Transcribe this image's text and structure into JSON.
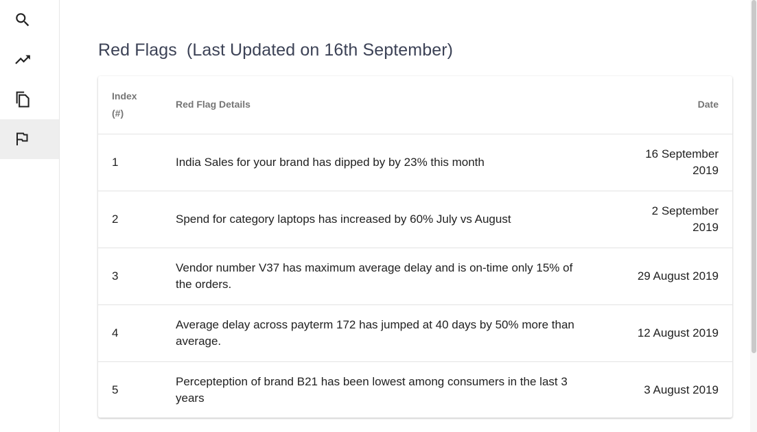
{
  "sidebar": {
    "items": [
      {
        "icon": "search-icon",
        "active": false
      },
      {
        "icon": "trending-up-icon",
        "active": false
      },
      {
        "icon": "copy-icon",
        "active": false
      },
      {
        "icon": "flag-icon",
        "active": true
      }
    ]
  },
  "page": {
    "title": "Red Flags  (Last Updated on 16th September)"
  },
  "table": {
    "headers": {
      "index": "Index (#)",
      "details": "Red Flag Details",
      "date": "Date"
    },
    "rows": [
      {
        "index": "1",
        "details": "India Sales for your brand has dipped by by 23% this month",
        "date": "16 September 2019"
      },
      {
        "index": "2",
        "details": "Spend for category laptops has increased by 60% July vs August",
        "date": "2 September 2019"
      },
      {
        "index": "3",
        "details": "Vendor number V37 has maximum average delay and is on-time only 15% of the orders.",
        "date": "29 August 2019"
      },
      {
        "index": "4",
        "details": "Average delay across payterm 172 has jumped at 40 days by 50% more than average.",
        "date": "12 August 2019"
      },
      {
        "index": "5",
        "details": "Percepteption of brand B21 has been lowest among consumers in the last 3 years",
        "date": "3 August 2019"
      }
    ]
  },
  "colors": {
    "sidebar_active_bg": "#eeeeee",
    "title": "#3c4256",
    "header_text": "#757575",
    "body_text": "#212121"
  }
}
